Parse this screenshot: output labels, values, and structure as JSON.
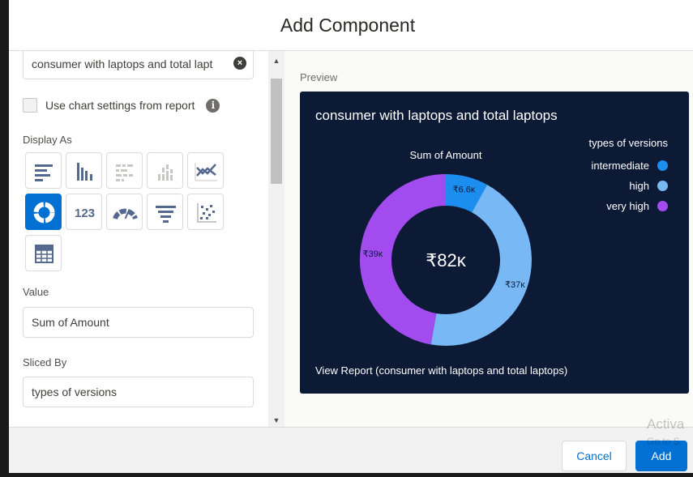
{
  "dialog": {
    "title": "Add Component"
  },
  "left": {
    "report_search_value": "consumer with laptops and total lapt",
    "use_chart_settings_label": "Use chart settings from report",
    "display_as_label": "Display As",
    "chart_types": [
      {
        "icon": "horizontal-bar-chart-icon",
        "selected": false
      },
      {
        "icon": "vertical-bar-chart-icon",
        "selected": false
      },
      {
        "icon": "stacked-horizontal-bar-icon",
        "selected": false
      },
      {
        "icon": "stacked-vertical-bar-icon",
        "selected": false
      },
      {
        "icon": "line-chart-icon",
        "selected": false
      },
      {
        "icon": "donut-chart-icon",
        "selected": true
      },
      {
        "icon": "metric-icon",
        "label": "123",
        "selected": false
      },
      {
        "icon": "gauge-icon",
        "selected": false
      },
      {
        "icon": "funnel-icon",
        "selected": false
      },
      {
        "icon": "scatter-chart-icon",
        "selected": false
      },
      {
        "icon": "table-icon",
        "selected": false
      }
    ],
    "value_label": "Value",
    "value_field": "Sum of Amount",
    "sliced_by_label": "Sliced By",
    "sliced_by_field": "types of versions"
  },
  "preview": {
    "label": "Preview",
    "card_title": "consumer with laptops and total laptops",
    "view_report_link": "View Report (consumer with laptops and total laptops)",
    "background_color": "#0c1a36"
  },
  "chart_data": {
    "type": "pie",
    "subtitle": "Sum of Amount",
    "center_label": "₹82ĸ",
    "total": 82,
    "legend_title": "types of versions",
    "legend_position": "top-right",
    "slices": [
      {
        "name": "intermediate",
        "value": 6.6,
        "label": "₹6.6ĸ",
        "color": "#1b8ef0"
      },
      {
        "name": "high",
        "value": 37,
        "label": "₹37ĸ",
        "color": "#78b9f5"
      },
      {
        "name": "very high",
        "value": 39,
        "label": "₹39ĸ",
        "color": "#a24cf0"
      }
    ]
  },
  "footer": {
    "cancel_label": "Cancel",
    "add_label": "Add"
  },
  "watermark": {
    "line1": "Activa",
    "line2": "Go to S"
  }
}
